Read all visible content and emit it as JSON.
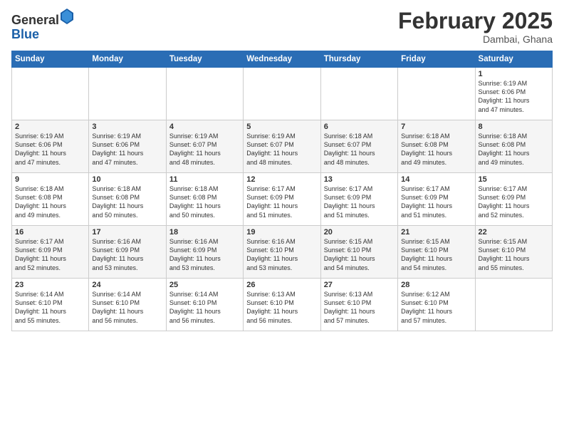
{
  "header": {
    "logo_general": "General",
    "logo_blue": "Blue",
    "month_title": "February 2025",
    "location": "Dambai, Ghana"
  },
  "days_of_week": [
    "Sunday",
    "Monday",
    "Tuesday",
    "Wednesday",
    "Thursday",
    "Friday",
    "Saturday"
  ],
  "weeks": [
    [
      {
        "day": "",
        "info": ""
      },
      {
        "day": "",
        "info": ""
      },
      {
        "day": "",
        "info": ""
      },
      {
        "day": "",
        "info": ""
      },
      {
        "day": "",
        "info": ""
      },
      {
        "day": "",
        "info": ""
      },
      {
        "day": "1",
        "info": "Sunrise: 6:19 AM\nSunset: 6:06 PM\nDaylight: 11 hours\nand 47 minutes."
      }
    ],
    [
      {
        "day": "2",
        "info": "Sunrise: 6:19 AM\nSunset: 6:06 PM\nDaylight: 11 hours\nand 47 minutes."
      },
      {
        "day": "3",
        "info": "Sunrise: 6:19 AM\nSunset: 6:06 PM\nDaylight: 11 hours\nand 47 minutes."
      },
      {
        "day": "4",
        "info": "Sunrise: 6:19 AM\nSunset: 6:07 PM\nDaylight: 11 hours\nand 48 minutes."
      },
      {
        "day": "5",
        "info": "Sunrise: 6:19 AM\nSunset: 6:07 PM\nDaylight: 11 hours\nand 48 minutes."
      },
      {
        "day": "6",
        "info": "Sunrise: 6:18 AM\nSunset: 6:07 PM\nDaylight: 11 hours\nand 48 minutes."
      },
      {
        "day": "7",
        "info": "Sunrise: 6:18 AM\nSunset: 6:08 PM\nDaylight: 11 hours\nand 49 minutes."
      },
      {
        "day": "8",
        "info": "Sunrise: 6:18 AM\nSunset: 6:08 PM\nDaylight: 11 hours\nand 49 minutes."
      }
    ],
    [
      {
        "day": "9",
        "info": "Sunrise: 6:18 AM\nSunset: 6:08 PM\nDaylight: 11 hours\nand 49 minutes."
      },
      {
        "day": "10",
        "info": "Sunrise: 6:18 AM\nSunset: 6:08 PM\nDaylight: 11 hours\nand 50 minutes."
      },
      {
        "day": "11",
        "info": "Sunrise: 6:18 AM\nSunset: 6:08 PM\nDaylight: 11 hours\nand 50 minutes."
      },
      {
        "day": "12",
        "info": "Sunrise: 6:17 AM\nSunset: 6:09 PM\nDaylight: 11 hours\nand 51 minutes."
      },
      {
        "day": "13",
        "info": "Sunrise: 6:17 AM\nSunset: 6:09 PM\nDaylight: 11 hours\nand 51 minutes."
      },
      {
        "day": "14",
        "info": "Sunrise: 6:17 AM\nSunset: 6:09 PM\nDaylight: 11 hours\nand 51 minutes."
      },
      {
        "day": "15",
        "info": "Sunrise: 6:17 AM\nSunset: 6:09 PM\nDaylight: 11 hours\nand 52 minutes."
      }
    ],
    [
      {
        "day": "16",
        "info": "Sunrise: 6:17 AM\nSunset: 6:09 PM\nDaylight: 11 hours\nand 52 minutes."
      },
      {
        "day": "17",
        "info": "Sunrise: 6:16 AM\nSunset: 6:09 PM\nDaylight: 11 hours\nand 53 minutes."
      },
      {
        "day": "18",
        "info": "Sunrise: 6:16 AM\nSunset: 6:09 PM\nDaylight: 11 hours\nand 53 minutes."
      },
      {
        "day": "19",
        "info": "Sunrise: 6:16 AM\nSunset: 6:10 PM\nDaylight: 11 hours\nand 53 minutes."
      },
      {
        "day": "20",
        "info": "Sunrise: 6:15 AM\nSunset: 6:10 PM\nDaylight: 11 hours\nand 54 minutes."
      },
      {
        "day": "21",
        "info": "Sunrise: 6:15 AM\nSunset: 6:10 PM\nDaylight: 11 hours\nand 54 minutes."
      },
      {
        "day": "22",
        "info": "Sunrise: 6:15 AM\nSunset: 6:10 PM\nDaylight: 11 hours\nand 55 minutes."
      }
    ],
    [
      {
        "day": "23",
        "info": "Sunrise: 6:14 AM\nSunset: 6:10 PM\nDaylight: 11 hours\nand 55 minutes."
      },
      {
        "day": "24",
        "info": "Sunrise: 6:14 AM\nSunset: 6:10 PM\nDaylight: 11 hours\nand 56 minutes."
      },
      {
        "day": "25",
        "info": "Sunrise: 6:14 AM\nSunset: 6:10 PM\nDaylight: 11 hours\nand 56 minutes."
      },
      {
        "day": "26",
        "info": "Sunrise: 6:13 AM\nSunset: 6:10 PM\nDaylight: 11 hours\nand 56 minutes."
      },
      {
        "day": "27",
        "info": "Sunrise: 6:13 AM\nSunset: 6:10 PM\nDaylight: 11 hours\nand 57 minutes."
      },
      {
        "day": "28",
        "info": "Sunrise: 6:12 AM\nSunset: 6:10 PM\nDaylight: 11 hours\nand 57 minutes."
      },
      {
        "day": "",
        "info": ""
      }
    ]
  ]
}
